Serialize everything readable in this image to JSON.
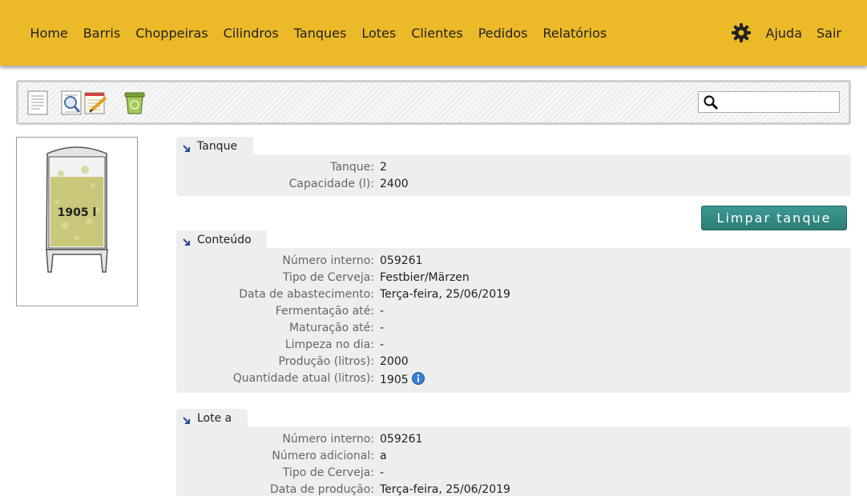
{
  "nav": {
    "items": [
      "Home",
      "Barris",
      "Choppeiras",
      "Cilindros",
      "Tanques",
      "Lotes",
      "Clientes",
      "Pedidos",
      "Relatórios"
    ],
    "help": "Ajuda",
    "logout": "Sair"
  },
  "toolbar": {
    "icons": [
      "document-icon",
      "search-document-icon",
      "edit-notepad-icon",
      "trash-can-icon"
    ],
    "search_placeholder": ""
  },
  "tank_image": {
    "label": "1905 l",
    "fill_fraction": 0.79
  },
  "sections": {
    "tanque": {
      "title": "Tanque",
      "rows": [
        {
          "label": "Tanque:",
          "value": "2"
        },
        {
          "label": "Capacidade (l):",
          "value": "2400"
        }
      ]
    },
    "clean_button": "Limpar tanque",
    "conteudo": {
      "title": "Conteúdo",
      "rows": [
        {
          "label": "Número interno:",
          "value": "059261"
        },
        {
          "label": "Tipo de Cerveja:",
          "value": "Festbier/Märzen"
        },
        {
          "label": "Data de abastecimento:",
          "value": "Terça-feira, 25/06/2019"
        },
        {
          "label": "Fermentação até:",
          "value": "-"
        },
        {
          "label": "Maturação até:",
          "value": "-"
        },
        {
          "label": "Limpeza no dia:",
          "value": "-"
        },
        {
          "label": "Produção (litros):",
          "value": "2000"
        },
        {
          "label": "Quantidade atual (litros):",
          "value": "1905"
        }
      ]
    },
    "lote": {
      "title": "Lote a",
      "rows": [
        {
          "label": "Número interno:",
          "value": "059261"
        },
        {
          "label": "Número adicional:",
          "value": "a"
        },
        {
          "label": "Tipo de Cerveja:",
          "value": "-"
        },
        {
          "label": "Data de produção:",
          "value": "Terça-feira, 25/06/2019"
        }
      ]
    }
  },
  "colors": {
    "topbar": "#ecba28",
    "button": "#2f827b",
    "section_bg": "#eeeeee",
    "beer": "#c9c87a"
  }
}
